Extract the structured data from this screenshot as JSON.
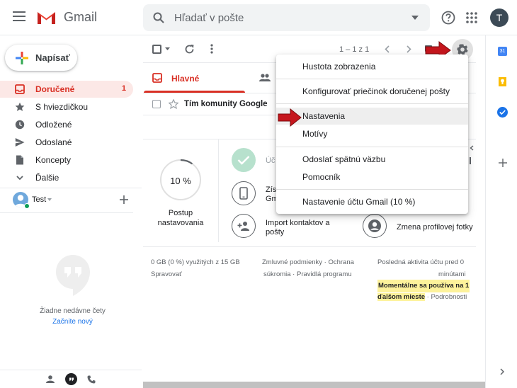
{
  "header": {
    "app_name": "Gmail",
    "search_placeholder": "Hľadať v pošte",
    "avatar_letter": "T"
  },
  "sidebar": {
    "compose_label": "Napísať",
    "items": [
      {
        "label": "Doručené",
        "count": "1",
        "icon": "inbox-icon",
        "active": true
      },
      {
        "label": "S hviezdičkou",
        "icon": "star-icon"
      },
      {
        "label": "Odložené",
        "icon": "clock-icon"
      },
      {
        "label": "Odoslané",
        "icon": "send-icon"
      },
      {
        "label": "Koncepty",
        "icon": "draft-icon"
      },
      {
        "label": "Ďalšie",
        "icon": "chevron-down-icon"
      }
    ],
    "hangouts_user": "Test",
    "no_chats": "Žiadne nedávne čety",
    "start_new": "Začnite nový"
  },
  "toolbar": {
    "pagination": "1 – 1 z 1"
  },
  "tabs": {
    "primary": "Hlavné"
  },
  "email_row": {
    "sender": "Tím komunity Google"
  },
  "setup": {
    "progress_percent": "10 %",
    "progress_value": 0.1,
    "progress_label_line1": "Postup",
    "progress_label_line2": "nastavovania",
    "item_truncated_1": "Úč",
    "item_truncated_2_line1": "Zís",
    "item_truncated_2_line2": "Gm",
    "import_line1": "Import kontaktov a",
    "import_line2": "pošty",
    "profile_photo": "Zmena profilovej fotky"
  },
  "footer": {
    "storage_line1": "0 GB (0 %) využitých z 15 GB",
    "storage_line2": "Spravovať",
    "terms_line1": "Zmluvné podmienky · Ochrana",
    "terms_line2": "súkromia · Pravidlá programu",
    "activity_line1": "Posledná aktivita účtu pred 0",
    "activity_line2": "minútami",
    "activity_line3": "Momentálne sa používa na 1",
    "activity_line4_hl": "ďalšom mieste",
    "activity_line4_rest": " · Podrobnosti"
  },
  "settings_menu": {
    "items": [
      "Hustota zobrazenia",
      "Konfigurovať priečinok doručenej pošty",
      "Nastavenia",
      "Motívy",
      "Odoslať spätnú väzbu",
      "Pomocník",
      "Nastavenie účtu Gmail (10 %)"
    ]
  },
  "colors": {
    "accent": "#d93025",
    "arrow": "#c5161d",
    "highlight": "#fdf29b"
  }
}
